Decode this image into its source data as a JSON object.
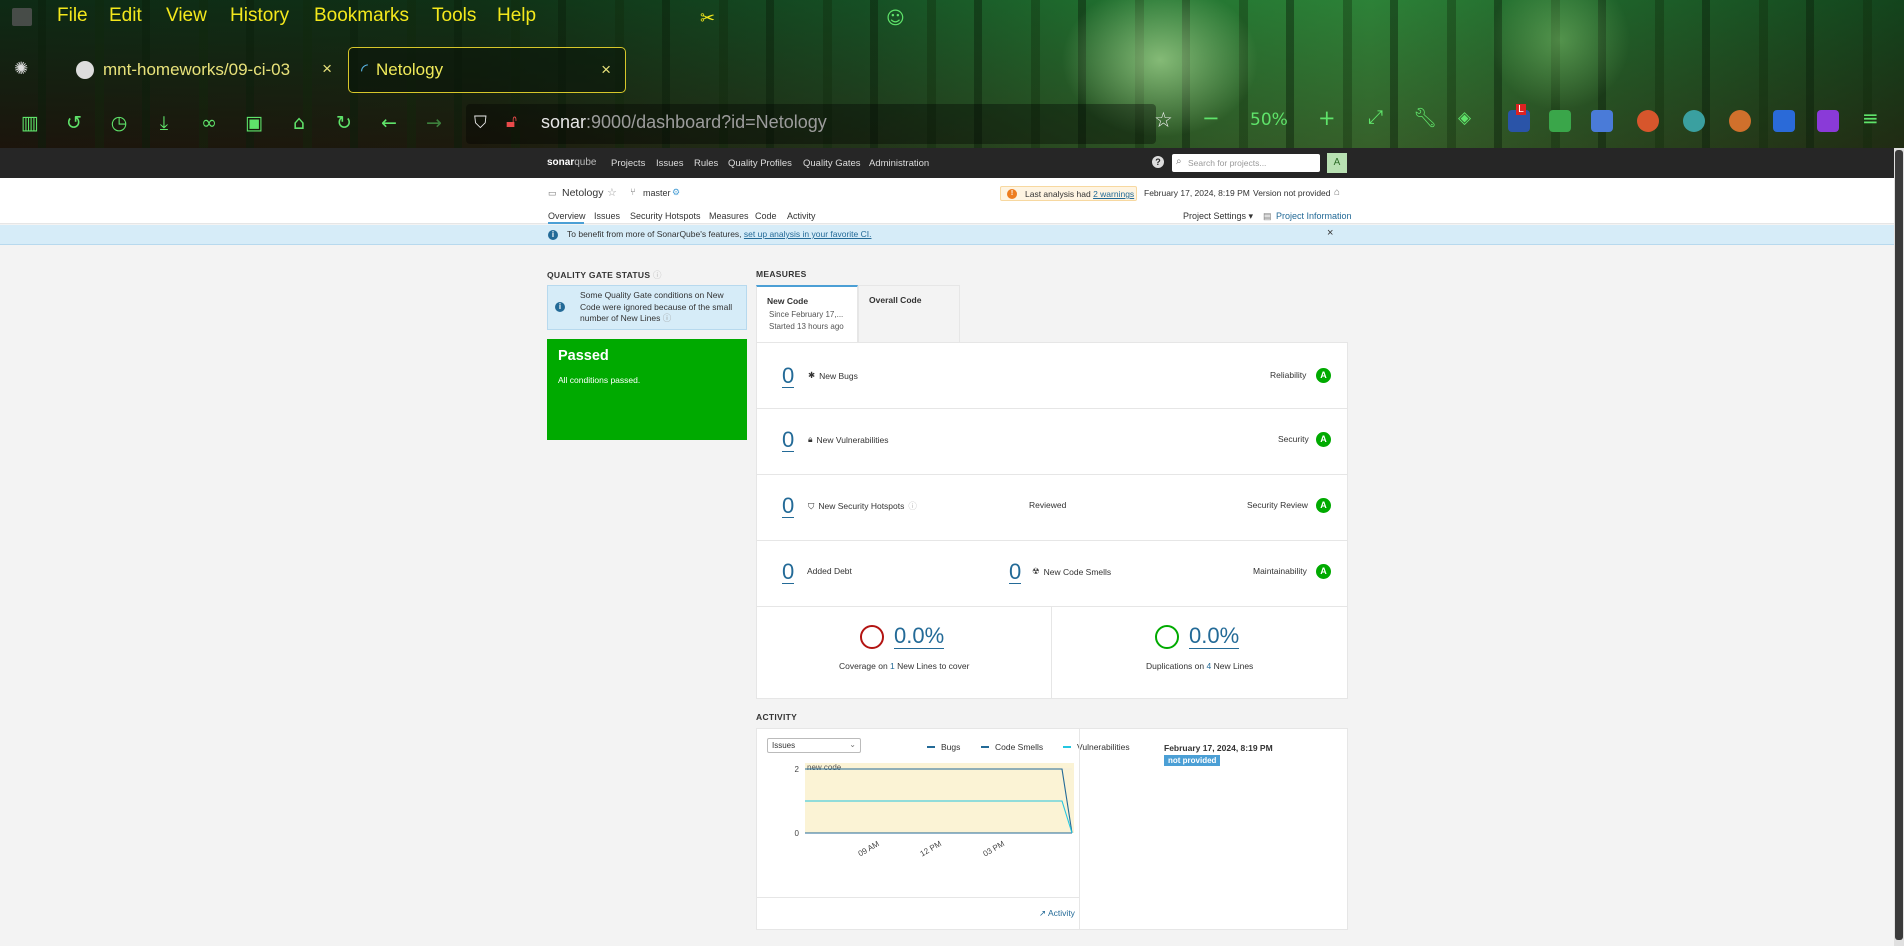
{
  "browser": {
    "menu": [
      "File",
      "Edit",
      "View",
      "History",
      "Bookmarks",
      "Tools",
      "Help"
    ],
    "tabs": [
      {
        "title": "mnt-homeworks/09-ci-03",
        "close": "×"
      },
      {
        "title": "Netology",
        "close": "×"
      }
    ],
    "url": {
      "host": "sonar",
      "rest": ":9000/dashboard?id=Netology"
    },
    "zoom": "50%",
    "icons": [
      "sidebar-icon",
      "history-icon",
      "clock-icon",
      "download-icon",
      "mask-icon",
      "screen-add-icon",
      "home-icon",
      "reload-icon",
      "back-icon",
      "forward-icon",
      "shield-icon",
      "lock-icon",
      "star-icon",
      "zoom-out-icon",
      "zoom-in-icon",
      "fullscreen-icon",
      "wrench-icon",
      "pocket-icon",
      "menu-icon"
    ]
  },
  "sonar": {
    "nav": {
      "logo_main": "sonar",
      "logo_sub": "qube",
      "items": [
        "Projects",
        "Issues",
        "Rules",
        "Quality Profiles",
        "Quality Gates",
        "Administration"
      ],
      "search_placeholder": "Search for projects...",
      "avatar": "A",
      "help": "?"
    },
    "project": {
      "name": "Netology",
      "branch": "master",
      "warning_prefix": "Last analysis had",
      "warning_link": "2 warnings",
      "date": "February 17, 2024, 8:19 PM",
      "version": "Version not provided",
      "tabs": [
        "Overview",
        "Issues",
        "Security Hotspots",
        "Measures",
        "Code",
        "Activity"
      ],
      "settings": "Project Settings",
      "info": "Project Information"
    },
    "banner": {
      "text": "To benefit from more of SonarQube's features,",
      "link": "set up analysis in your favorite CI.",
      "close": "×"
    },
    "quality_gate": {
      "title": "QUALITY GATE STATUS",
      "note": "Some Quality Gate conditions on New Code were ignored because of the small number of New Lines",
      "status": "Passed",
      "sub": "All conditions passed."
    },
    "measures": {
      "title": "MEASURES",
      "tab_new": "New Code",
      "tab_new_since": "Since February 17,...",
      "tab_new_started": "Started 13 hours ago",
      "tab_overall": "Overall Code",
      "rows": [
        {
          "value": "0",
          "label": "New Bugs",
          "right": "Reliability",
          "rating": "A"
        },
        {
          "value": "0",
          "label": "New Vulnerabilities",
          "right": "Security",
          "rating": "A"
        },
        {
          "value": "0",
          "label": "New Security Hotspots",
          "mid": "Reviewed",
          "right": "Security Review",
          "rating": "A"
        },
        {
          "value": "0",
          "label": "Added Debt",
          "value2": "0",
          "label2": "New Code Smells",
          "right": "Maintainability",
          "rating": "A"
        }
      ],
      "coverage": {
        "pct": "0.0%",
        "prefix": "Coverage on",
        "num": "1",
        "suffix": "New Lines to cover",
        "color": "#b31412"
      },
      "duplications": {
        "pct": "0.0%",
        "prefix": "Duplications on",
        "num": "4",
        "suffix": "New Lines",
        "color": "#00aa00"
      }
    },
    "activity": {
      "title": "ACTIVITY",
      "select": "Issues",
      "legend": [
        "Bugs",
        "Code Smells",
        "Vulnerabilities"
      ],
      "new_code": "new code",
      "date": "February 17, 2024, 8:19 PM",
      "badge": "not provided",
      "link": "Activity"
    }
  },
  "chart_data": {
    "type": "line",
    "x": [
      "09 AM",
      "12 PM",
      "03 PM"
    ],
    "yticks": [
      "0",
      "2"
    ],
    "ylim": [
      0,
      2
    ],
    "series": [
      {
        "name": "Bugs",
        "values": [
          0,
          0,
          0,
          0
        ]
      },
      {
        "name": "Code Smells",
        "values": [
          2,
          2,
          2,
          0
        ]
      },
      {
        "name": "Vulnerabilities",
        "values": [
          1,
          1,
          1,
          0
        ]
      }
    ],
    "annotation": "new code"
  }
}
